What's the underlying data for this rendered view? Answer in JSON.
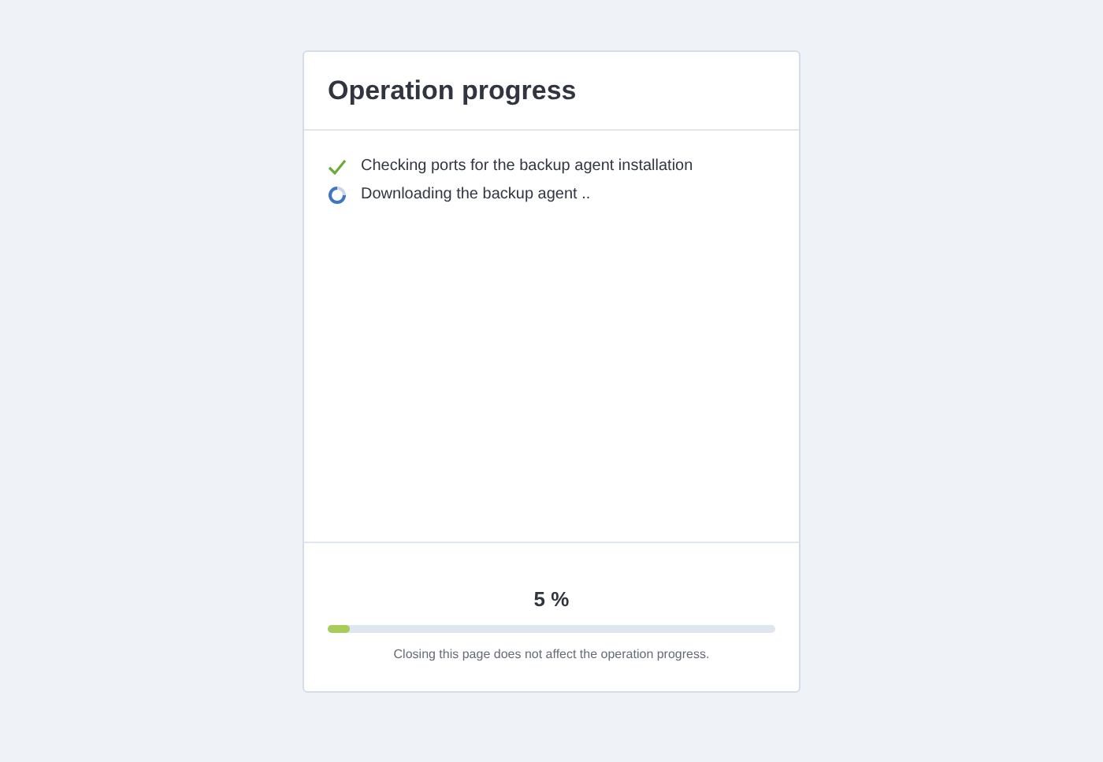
{
  "dialog": {
    "title": "Operation progress"
  },
  "steps": [
    {
      "kind": "done",
      "label": "Checking ports for the backup agent installation"
    },
    {
      "kind": "running",
      "label": "Downloading the backup agent .."
    }
  ],
  "progress": {
    "percent": "5 %",
    "level": 0.05,
    "note": "Closing this page does not affect the operation progress."
  }
}
